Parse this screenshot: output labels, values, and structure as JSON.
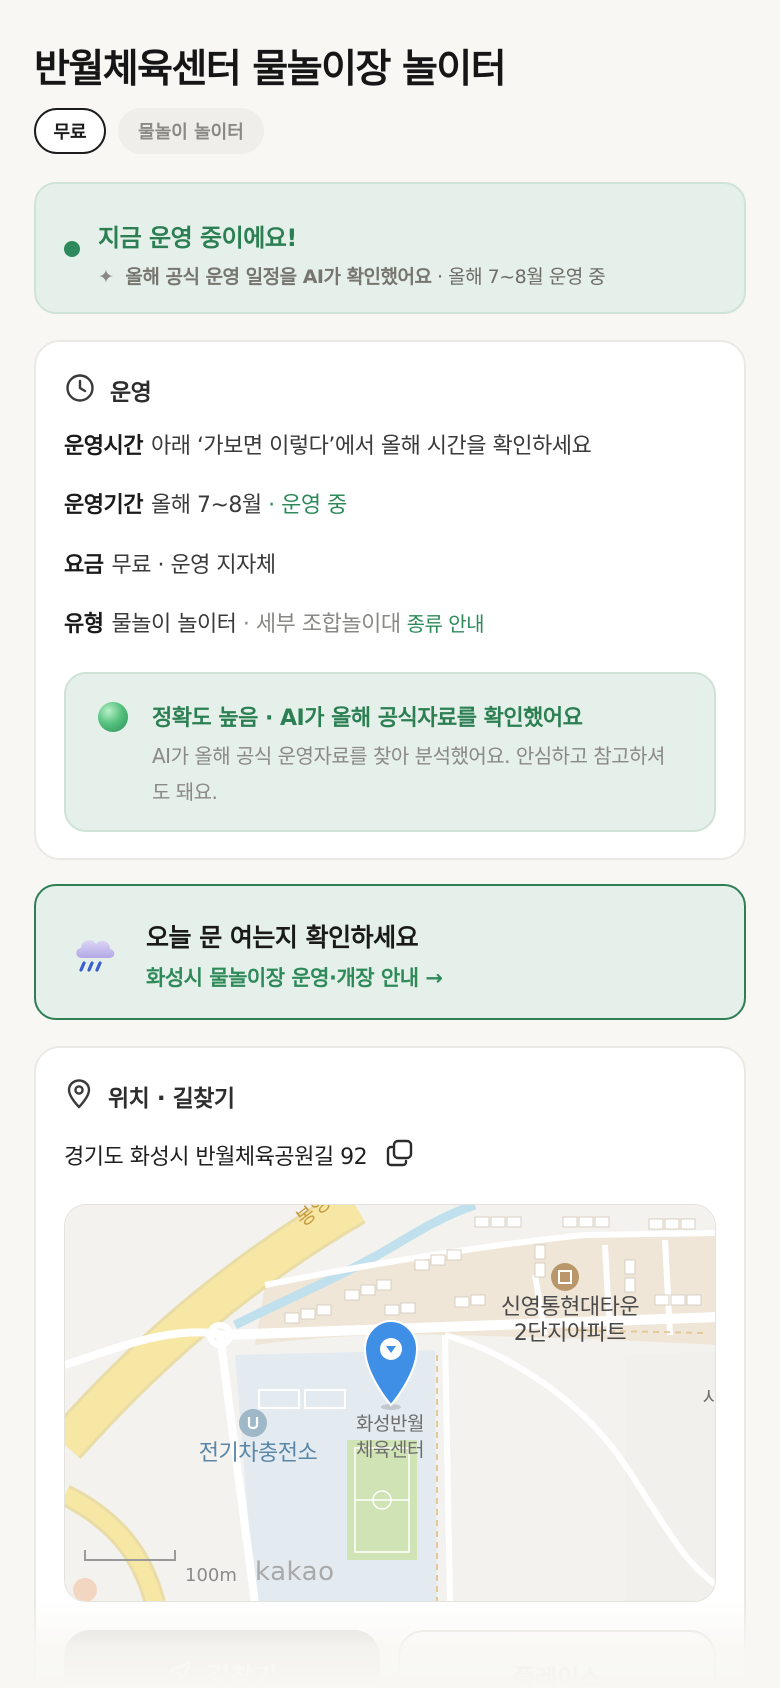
{
  "page": {
    "title": "반월체육센터 물놀이장 놀이터",
    "chips": [
      "무료",
      "물놀이 놀이터"
    ]
  },
  "status": {
    "title": "지금 운영 중이에요!",
    "sparkle": "✦",
    "sub_strong": "올해 공식 운영 일정을 AI가 확인했어요",
    "sub_rest": " · 올해 7~8월 운영 중",
    "dot_color": "#2e8a5c"
  },
  "operation": {
    "header": "운영",
    "icon": "clock-icon",
    "rows": {
      "hours": {
        "key": "운영시간",
        "value": "아래 ‘가보면 이렇다’에서 올해 시간을 확인하세요"
      },
      "period": {
        "key": "운영기간",
        "value": "올해 7~8월",
        "status": " · 운영 중"
      },
      "fee": {
        "key": "요금",
        "value": "무료 · 운영 지자체"
      },
      "type": {
        "key": "유형",
        "value": "물놀이 놀이터",
        "detail": " · 세부 조합놀이대",
        "link": "종류 안내"
      }
    },
    "accuracy": {
      "title": "정확도 높음 · AI가 올해 공식자료를 확인했어요",
      "body": "AI가 올해 공식 운영자료를 찾아 분석했어요. 안심하고 참고하셔도 돼요."
    }
  },
  "open_check": {
    "title": "오늘 문 여는지 확인하세요",
    "link": "화성시 물놀이장 운영·개장 안내 →",
    "icon": "rain-cloud-icon"
  },
  "location": {
    "header": "위치 · 길찾기",
    "icon": "location-pin-icon",
    "address": "경기도 화성시 반월체육공원길 92",
    "copy_icon": "copy-icon",
    "map": {
      "road_label": "봉영로",
      "apt_label_1": "신영통현대타운",
      "apt_label_2": "2단지아파트",
      "center_label_1": "화성반월",
      "center_label_2": "체육센터",
      "ev_label": "전기차충전소",
      "edge_label": "시",
      "scale": "100m",
      "brand": "kakao"
    },
    "buttons": {
      "directions": "길찾기",
      "place": "플레이스"
    }
  },
  "colors": {
    "accent_green": "#2f8a5a",
    "mint_bg": "#e6f0ea",
    "page_bg": "#f8f7f3",
    "marker_blue": "#3f8fe6"
  }
}
